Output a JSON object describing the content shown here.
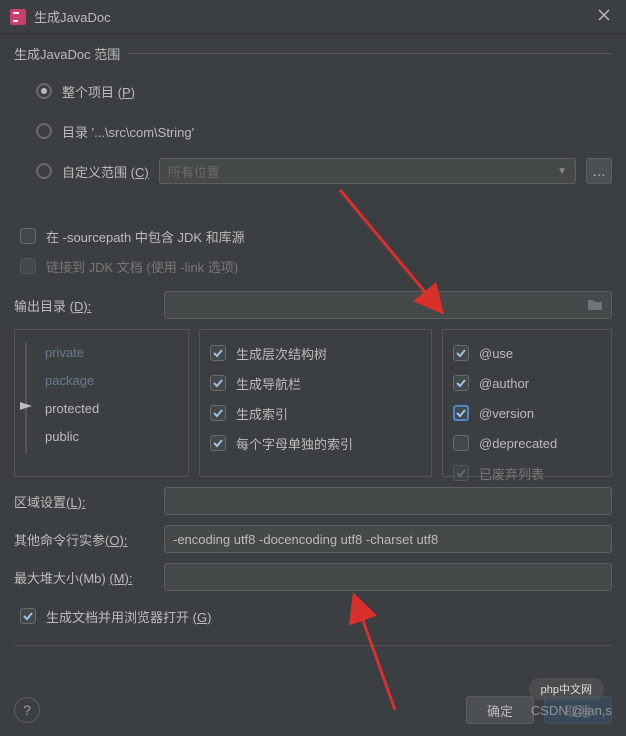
{
  "title": "生成JavaDoc",
  "scope": {
    "label": "生成JavaDoc 范围",
    "radios": {
      "whole_project": "整个项目",
      "whole_project_m": "(P)",
      "directory": "目录 '...\\src\\com\\String'",
      "custom_scope": "自定义范围",
      "custom_scope_m": "(C)"
    },
    "scope_combo": "所有位置"
  },
  "options": {
    "include_jdk": "在 -sourcepath 中包含 JDK 和库源",
    "link_jdk": "链接到 JDK 文档 (使用 -link 选项)"
  },
  "output": {
    "label": "输出目录",
    "label_m": "(D):",
    "value": ""
  },
  "visibility": {
    "private": "private",
    "package": "package",
    "protected": "protected",
    "public": "public"
  },
  "gen": {
    "tree": "生成层次结构树",
    "nav": "生成导航栏",
    "index": "生成索引",
    "sep": "每个字母单独的索引"
  },
  "tags": {
    "use": "@use",
    "author": "@author",
    "version": "@version",
    "deprecated": "@deprecated",
    "dep_list": "已废弃列表"
  },
  "locale": {
    "label": "区域设置",
    "label_m": "(L):",
    "value": ""
  },
  "args": {
    "label": "其他命令行实参",
    "label_m": "(O):",
    "value": "-encoding utf8 -docencoding utf8 -charset utf8"
  },
  "heap": {
    "label": "最大堆大小(Mb)",
    "label_m": "(M):",
    "value": ""
  },
  "open_browser": "生成文档并用浏览器打开",
  "open_browser_m": "(G)",
  "buttons": {
    "ok": "确定",
    "cancel": "取消"
  },
  "watermark": "CSDN @jan,s",
  "php_badge": "php中文网"
}
